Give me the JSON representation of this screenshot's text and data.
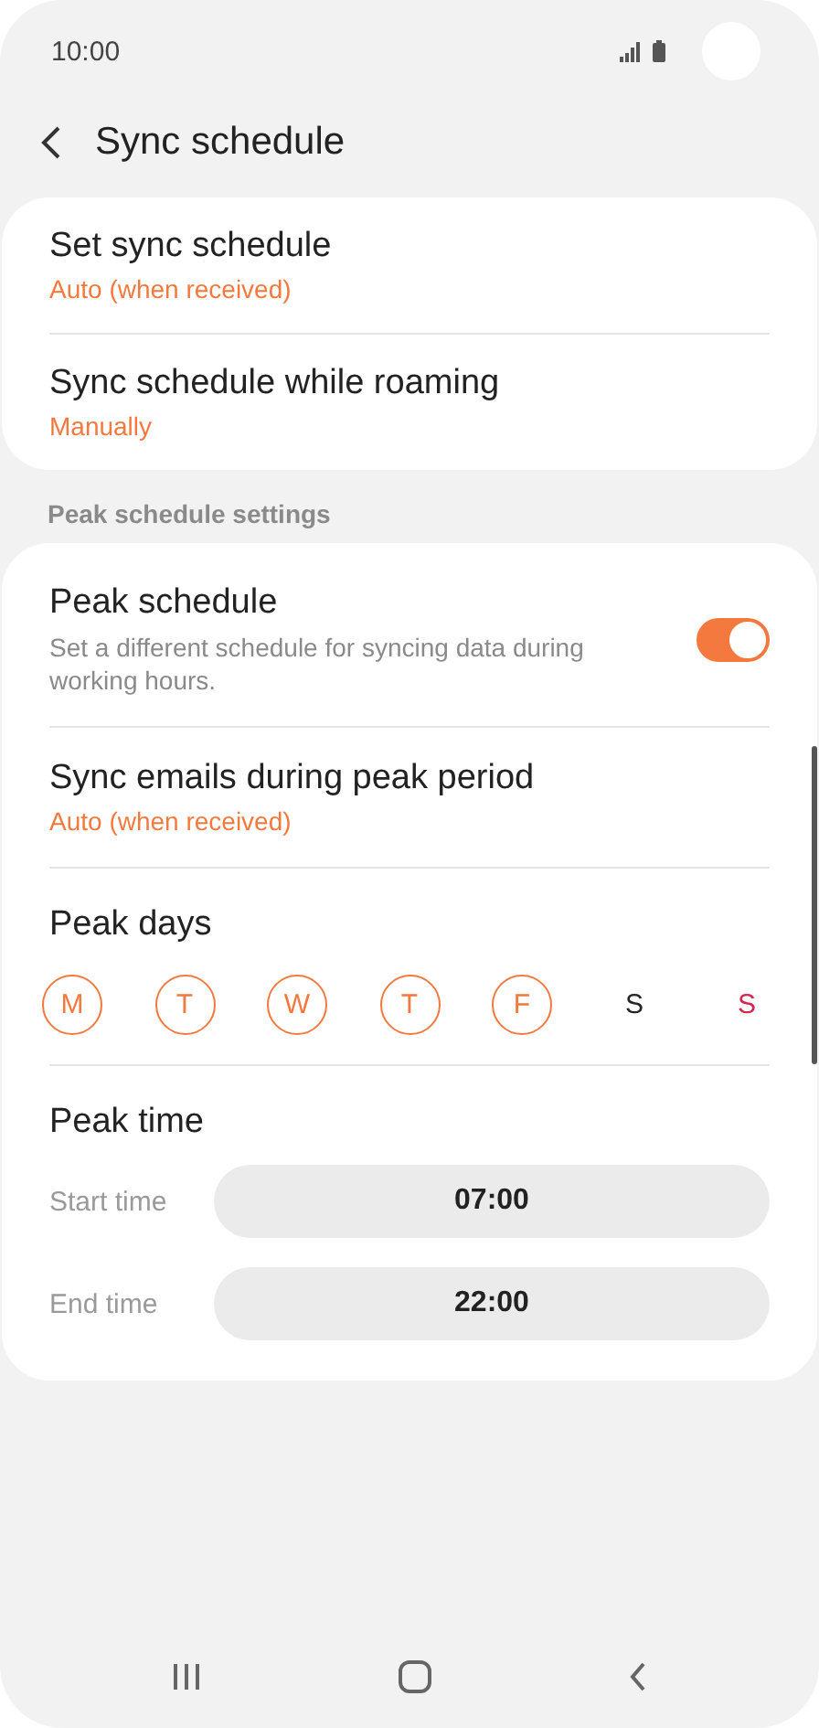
{
  "status_bar": {
    "time": "10:00"
  },
  "header": {
    "title": "Sync schedule"
  },
  "general": [
    {
      "title": "Set sync schedule",
      "value": "Auto (when received)"
    },
    {
      "title": "Sync schedule while roaming",
      "value": "Manually"
    }
  ],
  "peak_section": {
    "heading": "Peak schedule settings",
    "peak_schedule": {
      "title": "Peak schedule",
      "description": "Set a different schedule for syncing data during working hours.",
      "on": true
    },
    "sync_during_peak": {
      "title": "Sync emails during peak period",
      "value": "Auto (when received)"
    },
    "peak_days": {
      "title": "Peak days",
      "days": [
        {
          "label": "M",
          "selected": true,
          "color": "#f4793e"
        },
        {
          "label": "T",
          "selected": true,
          "color": "#f4793e"
        },
        {
          "label": "W",
          "selected": true,
          "color": "#f4793e"
        },
        {
          "label": "T",
          "selected": true,
          "color": "#f4793e"
        },
        {
          "label": "F",
          "selected": true,
          "color": "#f4793e"
        },
        {
          "label": "S",
          "selected": false,
          "color": "#252525"
        },
        {
          "label": "S",
          "selected": false,
          "color": "#d7264f"
        }
      ]
    },
    "peak_time": {
      "title": "Peak time",
      "rows": [
        {
          "label": "Start time",
          "value": "07:00"
        },
        {
          "label": "End time",
          "value": "22:00"
        }
      ]
    }
  }
}
